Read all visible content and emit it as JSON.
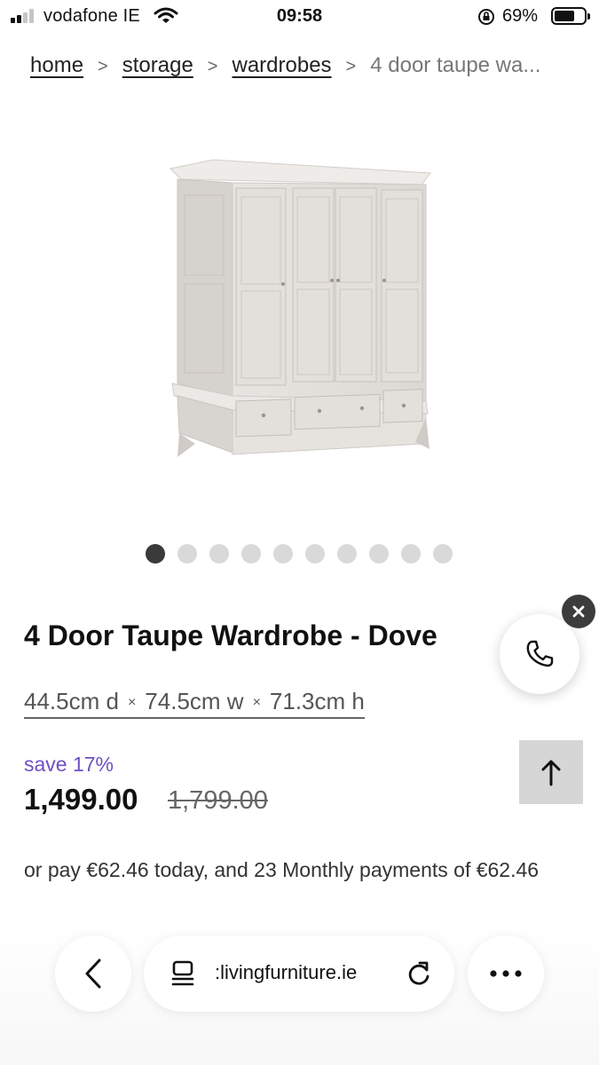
{
  "status_bar": {
    "carrier": "vodafone IE",
    "time": "09:58",
    "battery_percent": "69%",
    "battery_level": 0.69,
    "icons": [
      "signal-icon",
      "wifi-icon",
      "orientation-lock-icon",
      "battery-icon"
    ]
  },
  "breadcrumb": {
    "items": [
      {
        "label": "home"
      },
      {
        "label": "storage"
      },
      {
        "label": "wardrobes"
      }
    ],
    "separator": ">",
    "current": "4 door taupe wa..."
  },
  "product": {
    "title": "4 Door Taupe Wardrobe - Dove",
    "dimensions": {
      "depth": "44.5cm d",
      "width": "74.5cm w",
      "height": "71.3cm h",
      "separator": "×"
    },
    "save_label": "save 17%",
    "price": "1,499.00",
    "old_price": "1,799.00",
    "finance_text": "or pay €62.46 today, and 23 Monthly payments of €62.46",
    "image_count": 10,
    "active_image_index": 0
  },
  "widgets": {
    "call_icon": "phone-icon",
    "close_icon": "close-icon",
    "scroll_top_icon": "arrow-up-icon"
  },
  "browser": {
    "url": ":livingfurniture.ie",
    "icons": [
      "chevron-left-icon",
      "reader-icon",
      "reload-icon",
      "more-icon"
    ]
  },
  "colors": {
    "accent": "#6e4fc4",
    "dot_active": "#3a3a3a",
    "dot_inactive": "#d9d9d9",
    "close_bg": "#3c3c3c"
  }
}
